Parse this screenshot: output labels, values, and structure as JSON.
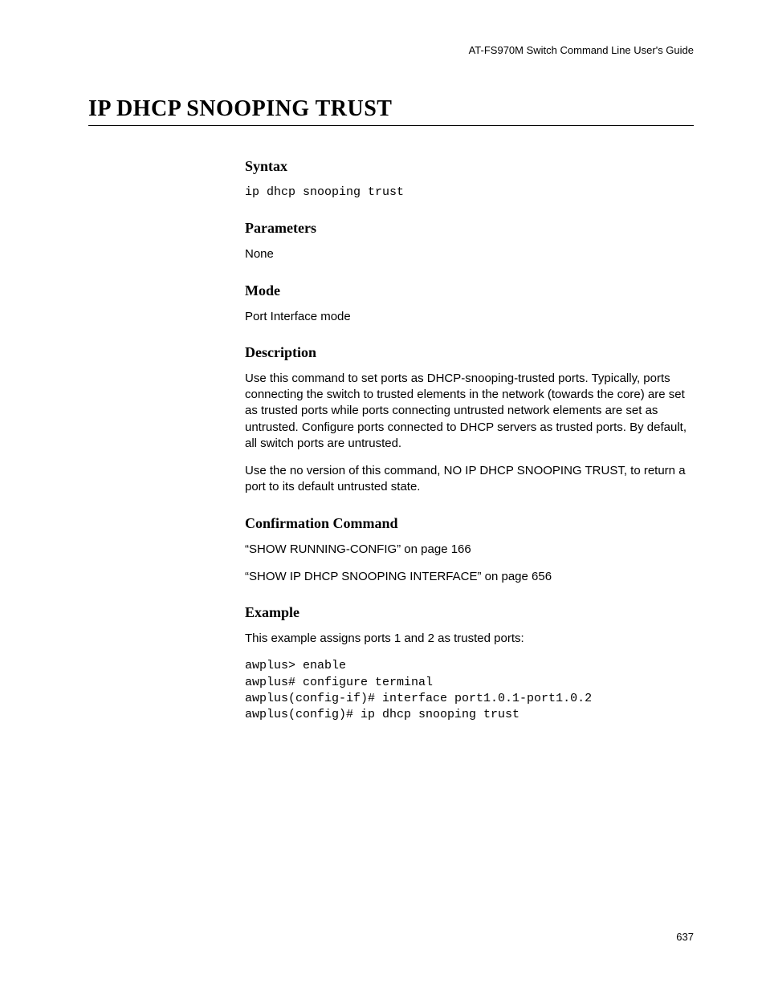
{
  "running_head": "AT-FS970M Switch Command Line User's Guide",
  "title": "IP DHCP SNOOPING TRUST",
  "sections": {
    "syntax": {
      "heading": "Syntax",
      "code": "ip dhcp snooping trust"
    },
    "parameters": {
      "heading": "Parameters",
      "text": "None"
    },
    "mode": {
      "heading": "Mode",
      "text": "Port Interface mode"
    },
    "description": {
      "heading": "Description",
      "p1": "Use this command to set ports as DHCP-snooping-trusted ports. Typically, ports connecting the switch to trusted elements in the network (towards the core) are set as trusted ports while ports connecting untrusted network elements are set as untrusted. Configure ports connected to DHCP servers as trusted ports. By default, all switch ports are untrusted.",
      "p2": "Use the no version of this command, NO IP DHCP SNOOPING TRUST, to return a port to its default untrusted state."
    },
    "confirmation": {
      "heading": "Confirmation Command",
      "p1": "“SHOW RUNNING-CONFIG” on page 166",
      "p2": "“SHOW IP DHCP SNOOPING INTERFACE” on page 656"
    },
    "example": {
      "heading": "Example",
      "intro": "This example assigns ports 1 and 2 as trusted ports:",
      "code": "awplus> enable\nawplus# configure terminal\nawplus(config-if)# interface port1.0.1-port1.0.2\nawplus(config)# ip dhcp snooping trust"
    }
  },
  "page_number": "637"
}
